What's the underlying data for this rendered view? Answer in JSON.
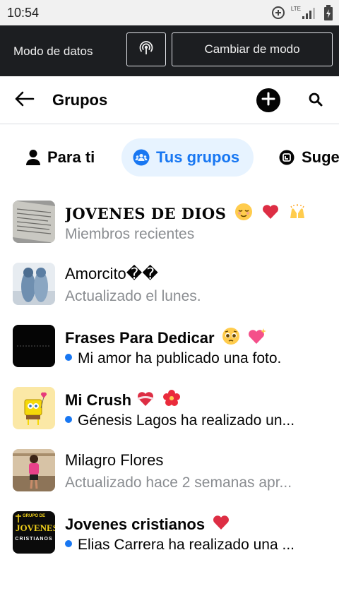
{
  "status_bar": {
    "time": "10:54",
    "icons": [
      "data-saver-icon",
      "lte-signal-icon",
      "battery-charging-icon"
    ],
    "lte_label": "LTE"
  },
  "data_mode_bar": {
    "label": "Modo de datos",
    "broadcast_icon": "broadcast-icon",
    "switch_button_label": "Cambiar de modo"
  },
  "header": {
    "title": "Grupos",
    "back_icon": "arrow-left-icon",
    "create_icon": "plus-circle-icon",
    "search_icon": "search-icon"
  },
  "tabs": [
    {
      "label": "Para ti",
      "icon": "person-icon",
      "active": false
    },
    {
      "label": "Tus grupos",
      "icon": "groups-icon",
      "active": true
    },
    {
      "label": "Suge",
      "icon": "compass-badge-icon",
      "active": false
    }
  ],
  "groups": [
    {
      "name": "JOVENES DE DIOS",
      "emojis": [
        "relieved-face",
        "red-heart",
        "raising-hands"
      ],
      "subtitle": "Miembros recientes",
      "unread": false
    },
    {
      "name": "Amorcito��",
      "emojis": [],
      "subtitle": "Actualizado el lunes.",
      "unread": false
    },
    {
      "name": "Frases Para Dedicar",
      "emojis": [
        "pleading-face",
        "sparkling-heart"
      ],
      "subtitle": "Mi amor ha publicado una foto.",
      "unread": true
    },
    {
      "name": "Mi Crush",
      "emojis": [
        "heart-with-ribbon",
        "hibiscus"
      ],
      "subtitle": "Génesis Lagos ha realizado un...",
      "unread": true
    },
    {
      "name": "Milagro Flores",
      "emojis": [],
      "subtitle": "Actualizado hace 2 semanas apr...",
      "unread": false
    },
    {
      "name": "Jovenes cristianos",
      "emojis": [
        "red-heart"
      ],
      "subtitle": "Elias Carrera ha realizado una ...",
      "unread": true
    }
  ],
  "thumbnails": {
    "jovenes_cristianos_lines": [
      "GRUPO DE",
      "JOVENES",
      "CRISTIANOS"
    ]
  },
  "colors": {
    "accent": "#1877f2",
    "active_tab_bg": "#e7f3ff",
    "dark_bar": "#1c1e21",
    "secondary_text": "#8a8d91"
  }
}
